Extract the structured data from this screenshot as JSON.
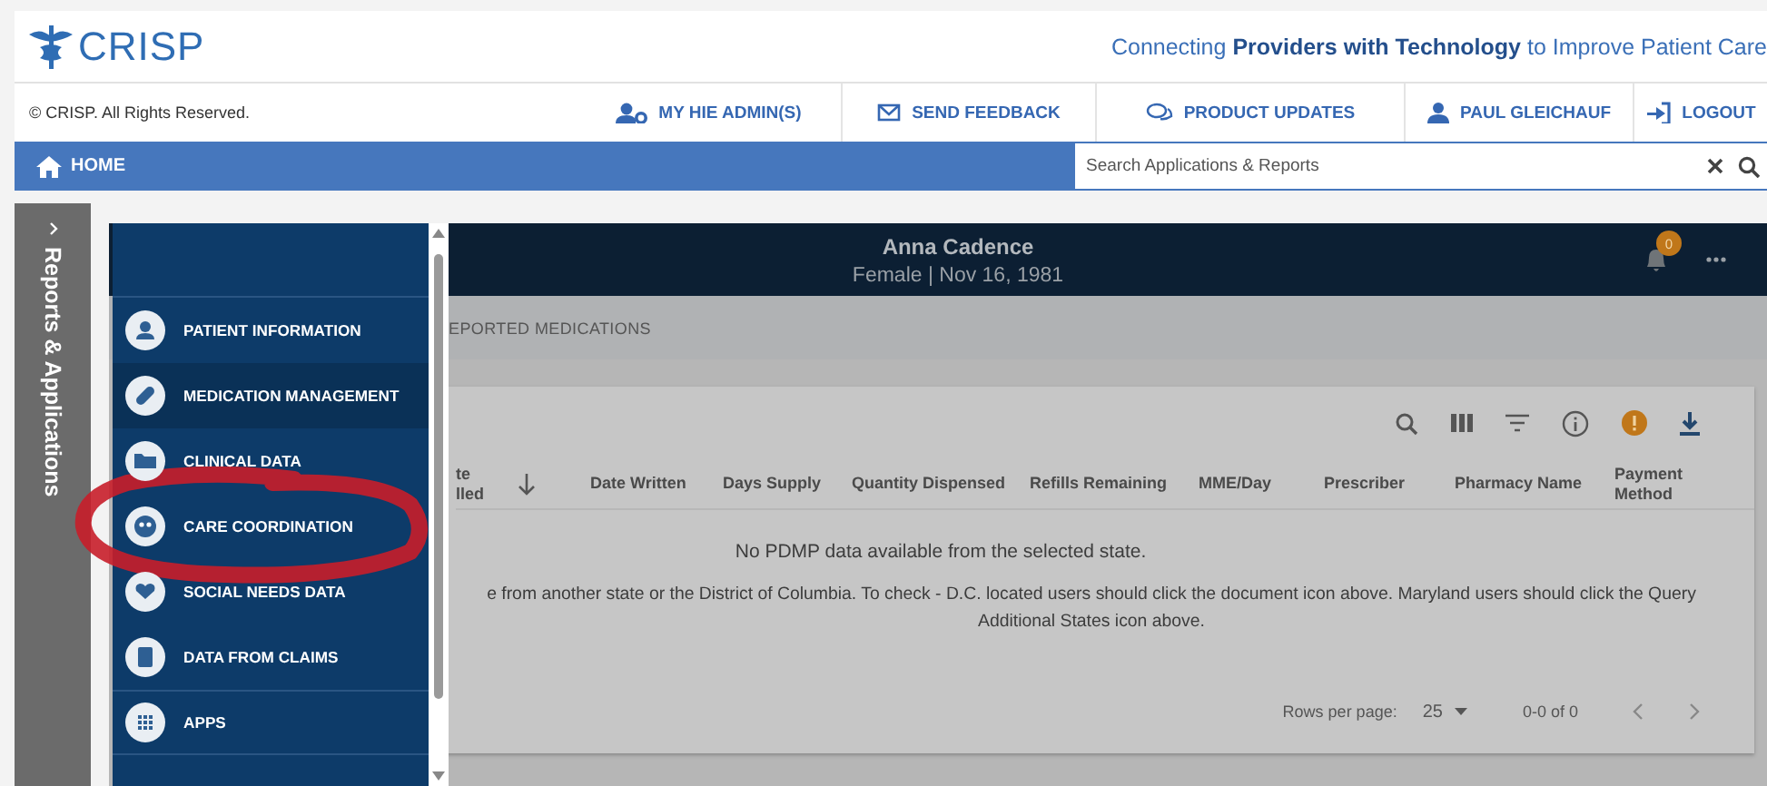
{
  "header": {
    "logo": "CRISP",
    "tagline": "Connecting **Providers with Technology** to Improve Patient Care"
  },
  "utility_bar": {
    "copyright": "© CRISP. All Rights Reserved.",
    "links": [
      {
        "kind": "admin",
        "label": "MY HIE ADMIN(S)"
      },
      {
        "kind": "feedback",
        "label": "SEND FEEDBACK"
      },
      {
        "kind": "updates",
        "label": "PRODUCT UPDATES"
      },
      {
        "kind": "user",
        "label": "PAUL GLEICHAUF"
      },
      {
        "kind": "logout",
        "label": "LOGOUT"
      }
    ]
  },
  "nav_bar": {
    "home": "HOME",
    "search": {
      "placeholder": "Search Applications & Reports"
    }
  },
  "side_tab": {
    "label": "Reports & Applications"
  },
  "menu": {
    "items": [
      {
        "kind": "person",
        "label": "PATIENT INFORMATION",
        "selected": false
      },
      {
        "kind": "pill",
        "label": "MEDICATION MANAGEMENT",
        "selected": true
      },
      {
        "kind": "folder",
        "label": "CLINICAL DATA",
        "selected": false
      },
      {
        "kind": "group",
        "label": "CARE COORDINATION",
        "selected": false
      },
      {
        "kind": "heart",
        "label": "SOCIAL NEEDS DATA",
        "selected": false
      },
      {
        "kind": "clipboard",
        "label": "DATA FROM CLAIMS",
        "selected": false
      },
      {
        "kind": "grid",
        "label": "APPS",
        "selected": false
      }
    ]
  },
  "patient": {
    "name": "Anna Cadence",
    "details": "Female | Nov 16, 1981",
    "notifications": "0"
  },
  "tab_label": "EPORTED MEDICATIONS",
  "table": {
    "columns": [
      {
        "label": "te lled",
        "sorted": true
      },
      {
        "label": "Date Written",
        "sorted": false
      },
      {
        "label": "Days Supply",
        "sorted": false
      },
      {
        "label": "Quantity Dispensed",
        "sorted": false
      },
      {
        "label": "Refills Remaining",
        "sorted": false
      },
      {
        "label": "MME/Day",
        "sorted": false
      },
      {
        "label": "Prescriber",
        "sorted": false
      },
      {
        "label": "Pharmacy Name",
        "sorted": false
      },
      {
        "label": "Payment Method",
        "sorted": false
      }
    ],
    "empty_message": "No PDMP data available from the selected state.",
    "note": "e from another state or the District of Columbia. To check - D.C. located users should click the document icon above. Maryland users should click the Query Additional States icon above.",
    "footer": {
      "rows_per_page_label": "Rows per page:",
      "rows_per_page": "25",
      "range": "0-0 of 0"
    }
  }
}
